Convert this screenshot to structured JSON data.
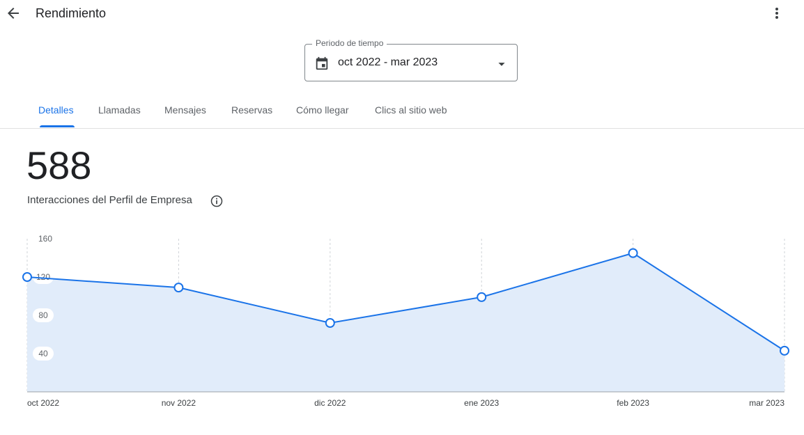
{
  "header": {
    "title": "Rendimiento",
    "back_icon": "arrow-back-icon",
    "more_icon": "more-vert-icon"
  },
  "period": {
    "label": "Periodo de tiempo",
    "value": "oct 2022 - mar 2023",
    "icon": "calendar-icon",
    "caret_icon": "dropdown-arrow-icon"
  },
  "tabs": [
    {
      "label": "Detalles",
      "active": true
    },
    {
      "label": "Llamadas",
      "active": false
    },
    {
      "label": "Mensajes",
      "active": false
    },
    {
      "label": "Reservas",
      "active": false
    },
    {
      "label": "Cómo llegar",
      "active": false
    },
    {
      "label": "Clics al sitio web",
      "active": false
    }
  ],
  "metric": {
    "value": "588",
    "label": "Interacciones del Perfil de Empresa",
    "info_icon": "info-icon"
  },
  "colors": {
    "accent": "#1a73e8",
    "area_fill": "#e1ecfa",
    "text": "#202124",
    "muted": "#5f6368"
  },
  "chart_data": {
    "type": "area",
    "categories": [
      "oct 2022",
      "nov 2022",
      "dic 2022",
      "ene 2023",
      "feb 2023",
      "mar 2023"
    ],
    "values": [
      120,
      109,
      72,
      99,
      145,
      43
    ],
    "yticks": [
      160,
      120,
      80,
      40
    ],
    "ylim": [
      0,
      160
    ],
    "grid": "vertical-dashed",
    "xlabel": "",
    "ylabel": ""
  }
}
